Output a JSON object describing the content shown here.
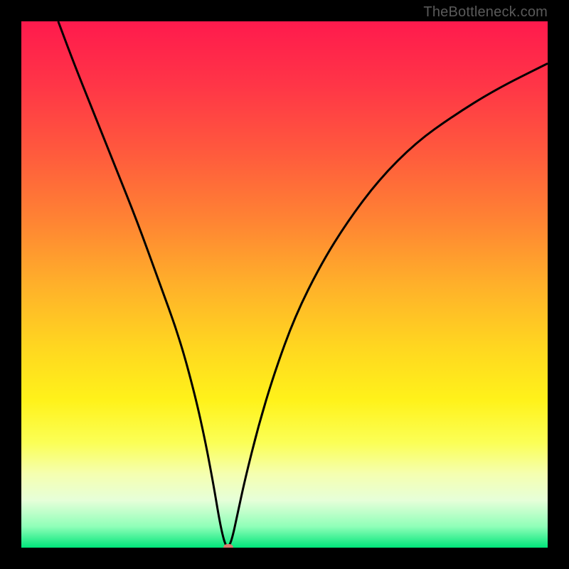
{
  "watermark": "TheBottleneck.com",
  "colors": {
    "black": "#000000",
    "curve": "#000000",
    "dot": "#d97a6f",
    "gradient_stops": [
      {
        "offset": 0.0,
        "color": "#ff1a4d"
      },
      {
        "offset": 0.12,
        "color": "#ff3547"
      },
      {
        "offset": 0.25,
        "color": "#ff5a3d"
      },
      {
        "offset": 0.38,
        "color": "#ff8433"
      },
      {
        "offset": 0.5,
        "color": "#ffb02a"
      },
      {
        "offset": 0.62,
        "color": "#ffd720"
      },
      {
        "offset": 0.72,
        "color": "#fff21a"
      },
      {
        "offset": 0.8,
        "color": "#fbff55"
      },
      {
        "offset": 0.86,
        "color": "#f5ffb0"
      },
      {
        "offset": 0.91,
        "color": "#e6ffd9"
      },
      {
        "offset": 0.96,
        "color": "#8fffb8"
      },
      {
        "offset": 1.0,
        "color": "#00e57a"
      }
    ]
  },
  "chart_data": {
    "type": "line",
    "title": "",
    "xlabel": "",
    "ylabel": "",
    "xlim": [
      0,
      100
    ],
    "ylim": [
      0,
      100
    ],
    "series": [
      {
        "name": "bottleneck-curve",
        "x": [
          7,
          10,
          14,
          18,
          22,
          26,
          30,
          33,
          35,
          36.5,
          37.5,
          38.2,
          38.8,
          39.3,
          40,
          41,
          42.5,
          45,
          48,
          52,
          57,
          62,
          68,
          75,
          82,
          90,
          100
        ],
        "y": [
          100,
          92,
          82,
          72,
          62,
          51,
          40,
          29,
          20,
          12,
          6,
          2.5,
          0.5,
          0,
          1.5,
          6,
          13,
          23,
          33,
          44,
          54,
          62,
          70,
          77,
          82,
          87,
          92
        ]
      }
    ],
    "marker": {
      "x": 39.3,
      "y": 0,
      "color": "#d97a6f"
    },
    "annotations": []
  }
}
